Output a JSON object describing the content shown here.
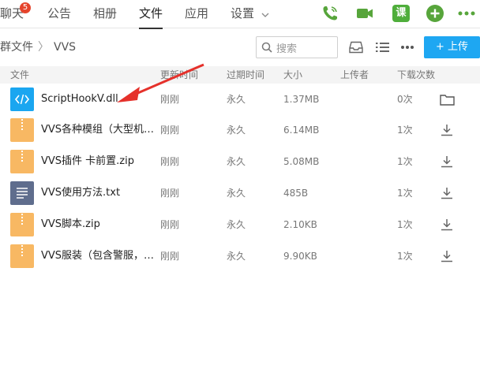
{
  "tabs": [
    {
      "label": "聊天",
      "badge": "5"
    },
    {
      "label": "公告"
    },
    {
      "label": "相册"
    },
    {
      "label": "文件",
      "active": true
    },
    {
      "label": "应用"
    },
    {
      "label": "设置"
    }
  ],
  "header_icons": {
    "phone": "phone-icon",
    "video": "video-icon",
    "course": {
      "icon": "course-icon",
      "label": "课"
    },
    "add": "add-circle-icon",
    "more": "more-icon"
  },
  "colors": {
    "accent_green": "#57a53b",
    "upload_blue": "#1ea7f2",
    "badge_red": "#e5442c",
    "annotation_red": "#e5312b"
  },
  "breadcrumb": {
    "root": "群文件",
    "current": "VVS"
  },
  "search": {
    "placeholder": "搜索"
  },
  "upload": {
    "label": "上传"
  },
  "columns": [
    "文件",
    "更新时间",
    "过期时间",
    "大小",
    "上传者",
    "下载次数"
  ],
  "files": [
    {
      "name": "ScriptHookV.dll",
      "icon": "dll-file-icon",
      "updated": "刚刚",
      "expires": "永久",
      "size": "1.37MB",
      "uploader": "",
      "downloads": "0次",
      "action": "folder-icon"
    },
    {
      "name": "VVS各种模组（大型机…",
      "icon": "zip-file-icon",
      "updated": "刚刚",
      "expires": "永久",
      "size": "6.14MB",
      "uploader": "",
      "downloads": "1次",
      "action": "download-icon"
    },
    {
      "name": "VVS插件 卡前置.zip",
      "icon": "zip-file-icon",
      "updated": "刚刚",
      "expires": "永久",
      "size": "5.08MB",
      "uploader": "",
      "downloads": "1次",
      "action": "download-icon"
    },
    {
      "name": "VVS使用方法.txt",
      "icon": "txt-file-icon",
      "updated": "刚刚",
      "expires": "永久",
      "size": "485B",
      "uploader": "",
      "downloads": "1次",
      "action": "download-icon"
    },
    {
      "name": "VVS脚本.zip",
      "icon": "zip-file-icon",
      "updated": "刚刚",
      "expires": "永久",
      "size": "2.10KB",
      "uploader": "",
      "downloads": "1次",
      "action": "download-icon"
    },
    {
      "name": "VVS服装（包含警服，…",
      "icon": "zip-file-icon",
      "updated": "刚刚",
      "expires": "永久",
      "size": "9.90KB",
      "uploader": "",
      "downloads": "1次",
      "action": "download-icon"
    }
  ]
}
